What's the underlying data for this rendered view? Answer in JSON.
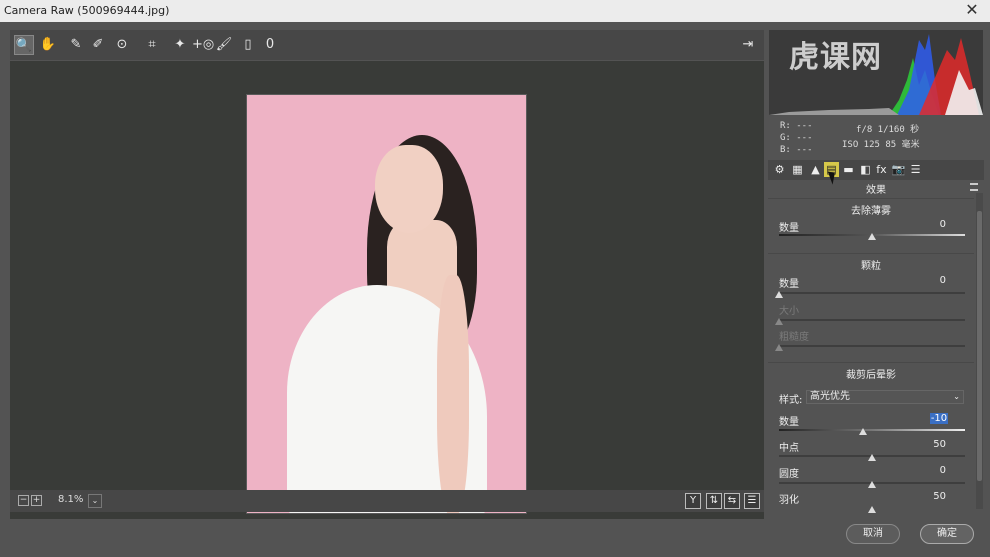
{
  "window": {
    "title": "Camera Raw (500969444.jpg)",
    "close_label": "✕"
  },
  "toolbar": {
    "tools": [
      {
        "name": "zoom-tool-icon",
        "glyph": "🔍"
      },
      {
        "name": "hand-tool-icon",
        "glyph": "✋"
      },
      {
        "name": "white-balance-tool-icon",
        "glyph": "✎"
      },
      {
        "name": "color-sampler-tool-icon",
        "glyph": "✐"
      },
      {
        "name": "targeted-adjustment-tool-icon",
        "glyph": "⊙"
      },
      {
        "name": "crop-tool-icon",
        "glyph": "⌗"
      },
      {
        "name": "spot-removal-tool-icon",
        "glyph": "✦"
      },
      {
        "name": "red-eye-tool-icon",
        "glyph": "+◎"
      },
      {
        "name": "adjustment-brush-icon",
        "glyph": "🖌"
      },
      {
        "name": "graduated-filter-icon",
        "glyph": "▯"
      },
      {
        "name": "radial-filter-icon",
        "glyph": "0"
      }
    ],
    "export_glyph": "⇥"
  },
  "bottom": {
    "zoom_out": "−",
    "zoom_in": "+",
    "zoom_level": "8.1%",
    "zoom_drop": "⌄",
    "view_y": "Y",
    "view_swap": "⇅",
    "view_copy": "⇆",
    "view_settings": "☰"
  },
  "histogram": {
    "watermark": "虎课网"
  },
  "info": {
    "r": "R:  ---",
    "g": "G:  ---",
    "b": "B:  ---",
    "aperture_shutter": "f/8   1/160 秒",
    "iso_focal": "ISO 125   85 毫米"
  },
  "tabs": [
    "⚙",
    "▦",
    "▲",
    "▤",
    "▬",
    "◧",
    "fx",
    "📷",
    "☰"
  ],
  "panel": {
    "title": "效果",
    "dehaze": {
      "title": "去除薄雾",
      "amount_label": "数量",
      "amount_value": "0"
    },
    "grain": {
      "title": "颗粒",
      "amount_label": "数量",
      "amount_value": "0",
      "size_label": "大小",
      "roughness_label": "粗糙度"
    },
    "vignette": {
      "title": "裁剪后晕影",
      "style_label": "样式:",
      "style_value": "高光优先",
      "style_arrow": "⌄",
      "amount_label": "数量",
      "amount_value": "-10",
      "midpoint_label": "中点",
      "midpoint_value": "50",
      "roundness_label": "圆度",
      "roundness_value": "0",
      "feather_label": "羽化",
      "feather_value": "50"
    }
  },
  "sliders": {
    "dehaze_amount": 0,
    "grain_amount": 0,
    "grain_size": 0,
    "grain_roughness": 0,
    "vignette_amount": -10,
    "vignette_midpoint": 50,
    "vignette_roundness": 0,
    "vignette_feather": 50
  },
  "buttons": {
    "cancel": "取消",
    "ok": "确定"
  }
}
